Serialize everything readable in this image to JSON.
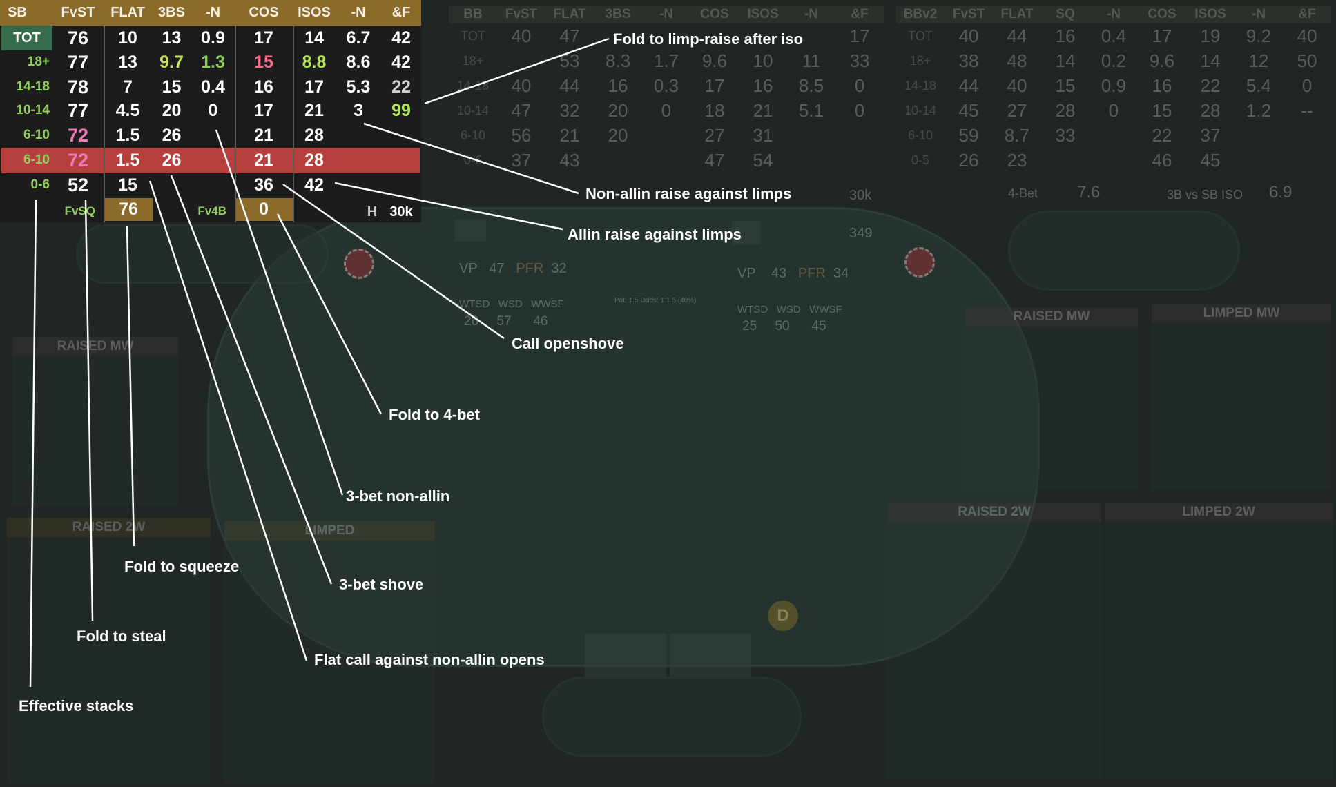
{
  "hud": {
    "headers": [
      "SB",
      "FvST",
      "FLAT",
      "3BS",
      "-N",
      "COS",
      "ISOS",
      "-N",
      "&F"
    ],
    "rows": [
      {
        "label": "TOT",
        "values": [
          "76",
          "10",
          "13",
          "0.9",
          "17",
          "14",
          "6.7",
          "42"
        ]
      },
      {
        "label": "18+",
        "values": [
          "77",
          "13",
          "9.7",
          "1.3",
          "15",
          "8.8",
          "8.6",
          "42"
        ]
      },
      {
        "label": "14-18",
        "values": [
          "78",
          "7",
          "15",
          "0.4",
          "16",
          "17",
          "5.3",
          "22"
        ]
      },
      {
        "label": "10-14",
        "values": [
          "77",
          "4.5",
          "20",
          "0",
          "17",
          "21",
          "3",
          "99"
        ]
      },
      {
        "label": "6-10",
        "values": [
          "72",
          "1.5",
          "26",
          "",
          "21",
          "28",
          "",
          ""
        ]
      },
      {
        "label": "6-10",
        "values": [
          "72",
          "1.5",
          "26",
          "",
          "21",
          "28",
          "",
          ""
        ]
      },
      {
        "label": "0-6",
        "values": [
          "52",
          "15",
          "",
          "",
          "36",
          "42",
          "",
          ""
        ]
      }
    ],
    "footer": {
      "fvsq_label": "FvSQ",
      "fvsq_value": "76",
      "fv4b_label": "Fv4B",
      "fv4b_value": "0",
      "h_label": "H",
      "hands": "30k"
    }
  },
  "callouts": {
    "c1": "Fold to limp-raise after iso",
    "c2": "Non-allin raise against limps",
    "c3": "Allin raise against limps",
    "c4": "Call openshove",
    "c5": "Fold to 4-bet",
    "c6": "3-bet non-allin",
    "c7": "Fold to squeeze",
    "c8": "3-bet shove",
    "c9": "Fold to steal",
    "c10": "Flat call against non-allin opens",
    "c11": "Effective stacks"
  },
  "bg": {
    "bb_headers": [
      "BB",
      "FvST",
      "FLAT",
      "3BS",
      "-N",
      "COS",
      "ISOS",
      "-N",
      "&F"
    ],
    "bb_rows": [
      [
        "TOT",
        "40",
        "47",
        "",
        "",
        "",
        "",
        "",
        "17"
      ],
      [
        "18+",
        "",
        "53",
        "8.3",
        "1.7",
        "9.6",
        "10",
        "11",
        "33"
      ],
      [
        "14-18",
        "40",
        "44",
        "16",
        "0.3",
        "17",
        "16",
        "8.5",
        "0"
      ],
      [
        "10-14",
        "47",
        "32",
        "20",
        "0",
        "18",
        "21",
        "5.1",
        "0"
      ],
      [
        "6-10",
        "56",
        "21",
        "20",
        "",
        "27",
        "31",
        "",
        ""
      ],
      [
        "0-6",
        "37",
        "43",
        "",
        "",
        "47",
        "54",
        "",
        ""
      ]
    ],
    "bbv2_headers": [
      "BBv2",
      "FvST",
      "FLAT",
      "SQ",
      "-N",
      "COS",
      "ISOS",
      "-N",
      "&F"
    ],
    "bbv2_rows": [
      [
        "TOT",
        "40",
        "44",
        "16",
        "0.4",
        "17",
        "19",
        "9.2",
        "40"
      ],
      [
        "18+",
        "38",
        "48",
        "14",
        "0.2",
        "9.6",
        "14",
        "12",
        "50"
      ],
      [
        "14-18",
        "44",
        "40",
        "15",
        "0.9",
        "16",
        "22",
        "5.4",
        "0"
      ],
      [
        "10-14",
        "45",
        "27",
        "28",
        "0",
        "15",
        "28",
        "1.2",
        "--"
      ],
      [
        "6-10",
        "59",
        "8.7",
        "33",
        "",
        "22",
        "37",
        "",
        ""
      ],
      [
        "0-5",
        "26",
        "23",
        "",
        "",
        "46",
        "45",
        "",
        ""
      ]
    ],
    "bb_foot": [
      "4-Bet",
      "7.6",
      "3B vs SB ISO",
      "6.9"
    ],
    "raised_mw": "RAISED MW",
    "limped_mw": "LIMPED MW",
    "raised_2w": "RAISED 2W",
    "limped_2w": "LIMPED 2W",
    "limped": "LIMPED",
    "vp1": [
      "VP",
      "47",
      "PFR",
      "32"
    ],
    "vp2": [
      "VP",
      "43",
      "PFR",
      "34"
    ],
    "stats1": [
      "WTSD",
      "WSD",
      "WWSF",
      "26",
      "57",
      "46"
    ],
    "stats2": [
      "WTSD",
      "WSD",
      "WWSF",
      "25",
      "50",
      "45"
    ],
    "pot": "Pot: 1.5    Odds: 1:1.5 (40%)",
    "dealer": "D",
    "stack_a": "30k",
    "stack_b": "349"
  },
  "colors": {
    "header": "#8c6a2a",
    "tot": "#356b4a",
    "highlight": "#b5403e",
    "green": "#8fd05a",
    "pink": "#f07ab8",
    "red": "#ff6b6b",
    "grey": "#d0d0d0"
  }
}
